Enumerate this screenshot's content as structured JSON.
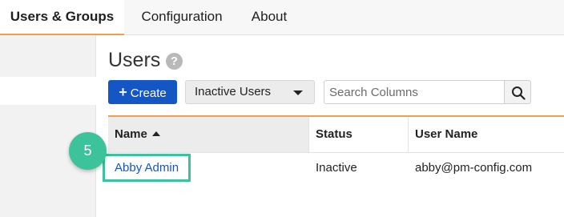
{
  "top_nav": {
    "tabs": [
      {
        "label": "Users & Groups",
        "active": true
      },
      {
        "label": "Configuration",
        "active": false
      },
      {
        "label": "About",
        "active": false
      }
    ],
    "active_color": "#f0a04b"
  },
  "page": {
    "title": "Users",
    "help_icon": "question-circle-icon",
    "help_glyph": "?"
  },
  "toolbar": {
    "create_label": "Create",
    "create_icon": "plus-icon",
    "create_glyph": "+",
    "filter_selected": "Inactive Users",
    "search_placeholder": "Search Columns",
    "search_value": "",
    "search_icon": "magnifier-icon"
  },
  "table": {
    "columns": [
      "Name",
      "Status",
      "User Name"
    ],
    "sort_column": "Name",
    "sort_direction": "ascending",
    "rows": [
      {
        "name": "Abby Admin",
        "status": "Inactive",
        "user_name": "abby@pm-config.com"
      }
    ]
  },
  "annotation": {
    "step_number": "5",
    "color": "#3cc39b"
  },
  "colors": {
    "primary": "#1456c4",
    "accent": "#f0a04b",
    "highlight": "#3cc39b"
  }
}
